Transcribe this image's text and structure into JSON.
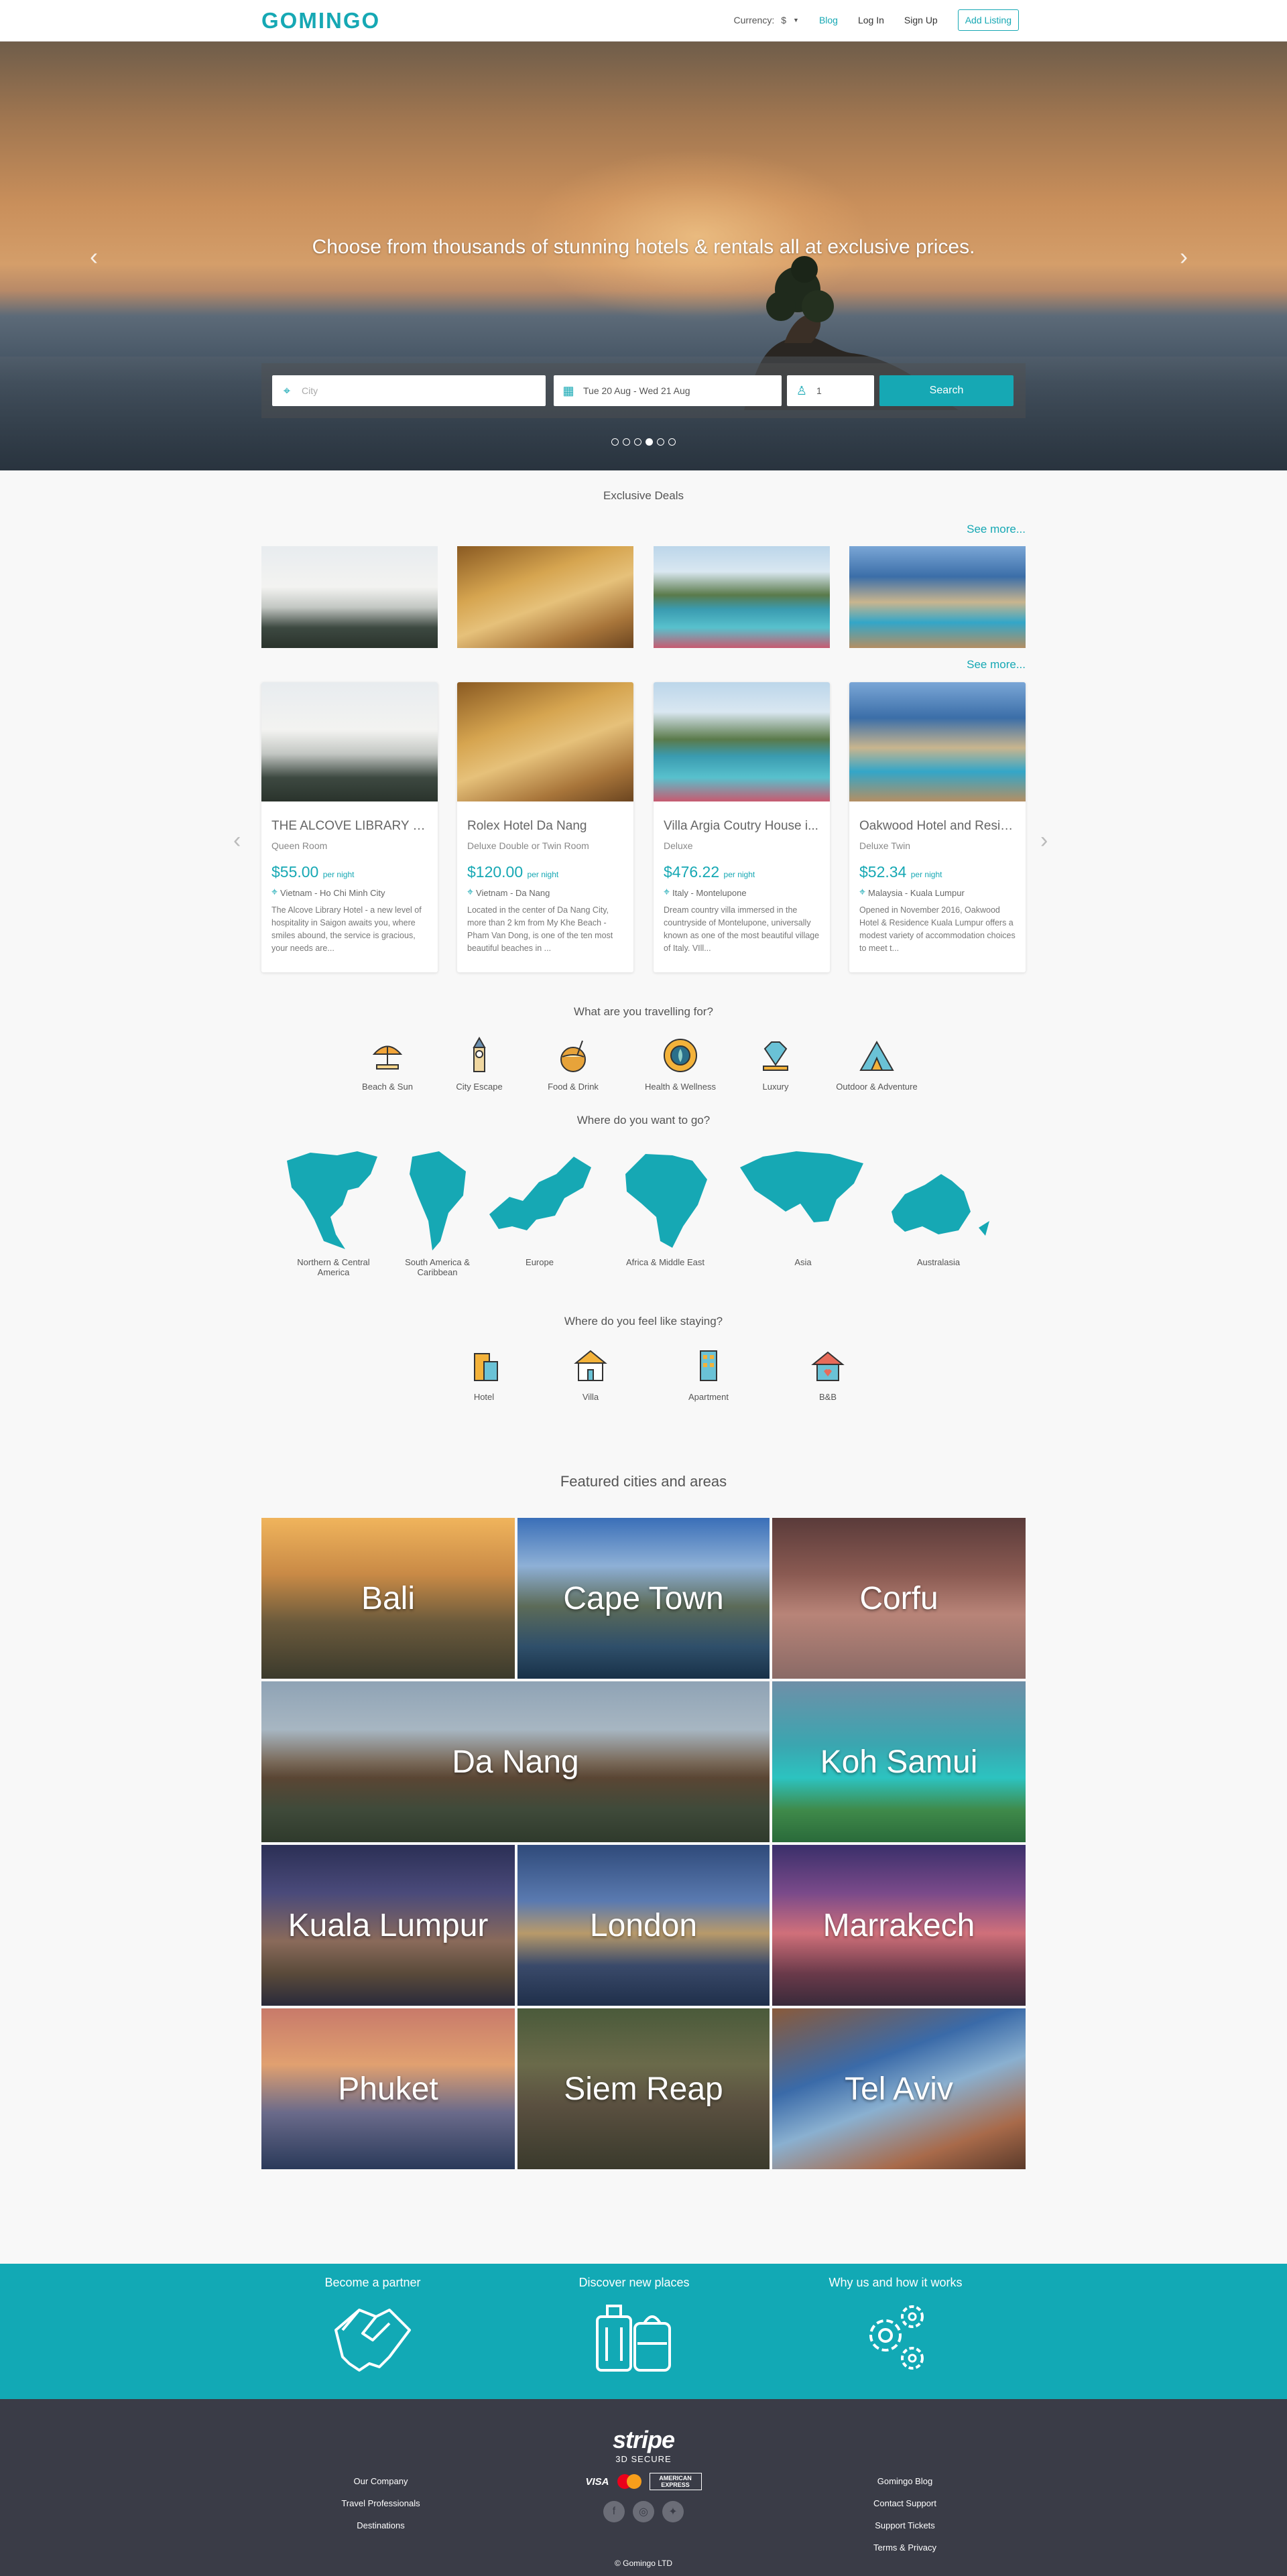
{
  "header": {
    "logo": "GOMINGO",
    "currency_label": "Currency:",
    "currency_value": "$",
    "blog": "Blog",
    "login": "Log In",
    "signup": "Sign Up",
    "add_listing": "Add Listing"
  },
  "hero": {
    "title": "Choose from thousands of stunning hotels & rentals all at exclusive prices.",
    "city_placeholder": "City",
    "dates": "Tue 20 Aug - Wed 21 Aug",
    "guests": "1",
    "search_label": "Search"
  },
  "deals": {
    "title": "Exclusive Deals",
    "see_more": "See more...",
    "cards": [
      {
        "name": "THE ALCOVE LIBRARY H...",
        "room": "Queen Room",
        "price": "$55.00",
        "per": "per night",
        "location": "Vietnam - Ho Chi Minh City",
        "desc": "The Alcove Library Hotel - a new level of hospitality in Saigon awaits you, where smiles abound, the service is gracious, your needs are..."
      },
      {
        "name": "Rolex Hotel Da Nang",
        "room": "Deluxe Double or Twin Room",
        "price": "$120.00",
        "per": "per night",
        "location": "Vietnam - Da Nang",
        "desc": "Located in the center of Da Nang City, more than 2 km from My Khe Beach - Pham Van Dong, is one of the ten most beautiful beaches in ..."
      },
      {
        "name": "Villa Argia Coutry House i...",
        "room": "Deluxe",
        "price": "$476.22",
        "per": "per night",
        "location": "Italy - Montelupone",
        "desc": "Dream country villa immersed in the countryside of Montelupone, universally known as one of the most beautiful village of Italy. VIll..."
      },
      {
        "name": "Oakwood Hotel and Resid...",
        "room": "Deluxe Twin",
        "price": "$52.34",
        "per": "per night",
        "location": "Malaysia - Kuala Lumpur",
        "desc": "Opened in November 2016, Oakwood Hotel & Residence Kuala Lumpur offers a modest variety of accommodation choices to meet t..."
      }
    ]
  },
  "travel_for": {
    "title": "What are you travelling for?",
    "items": [
      "Beach & Sun",
      "City Escape",
      "Food & Drink",
      "Health & Wellness",
      "Luxury",
      "Outdoor & Adventure"
    ]
  },
  "where_go": {
    "title": "Where do you want to go?",
    "items": [
      "Northern & Central America",
      "South America & Caribbean",
      "Europe",
      "Africa & Middle East",
      "Asia",
      "Australasia"
    ]
  },
  "staying": {
    "title": "Where do you feel like staying?",
    "items": [
      "Hotel",
      "Villa",
      "Apartment",
      "B&B"
    ]
  },
  "featured": {
    "title": "Featured cities and areas",
    "cities": [
      "Bali",
      "Cape Town",
      "Corfu",
      "Da Nang",
      "Koh Samui",
      "Kuala Lumpur",
      "London",
      "Marrakech",
      "Phuket",
      "Siem Reap",
      "Tel Aviv"
    ]
  },
  "band": {
    "partner": "Become a partner",
    "discover": "Discover new places",
    "why": "Why us and how it works"
  },
  "footer": {
    "stripe": "stripe",
    "secure": "3D SECURE",
    "visa": "VISA",
    "amex": "AMERICAN EXPRESS",
    "left_links": [
      "Our Company",
      "Travel Professionals",
      "Destinations"
    ],
    "right_links": [
      "Gomingo Blog",
      "Contact Support",
      "Support Tickets",
      "Terms & Privacy"
    ],
    "copyright": "© Gomingo LTD"
  },
  "colors": {
    "accent": "#16a8b4",
    "footer": "#3a3c47",
    "band": "#12a9b5"
  }
}
